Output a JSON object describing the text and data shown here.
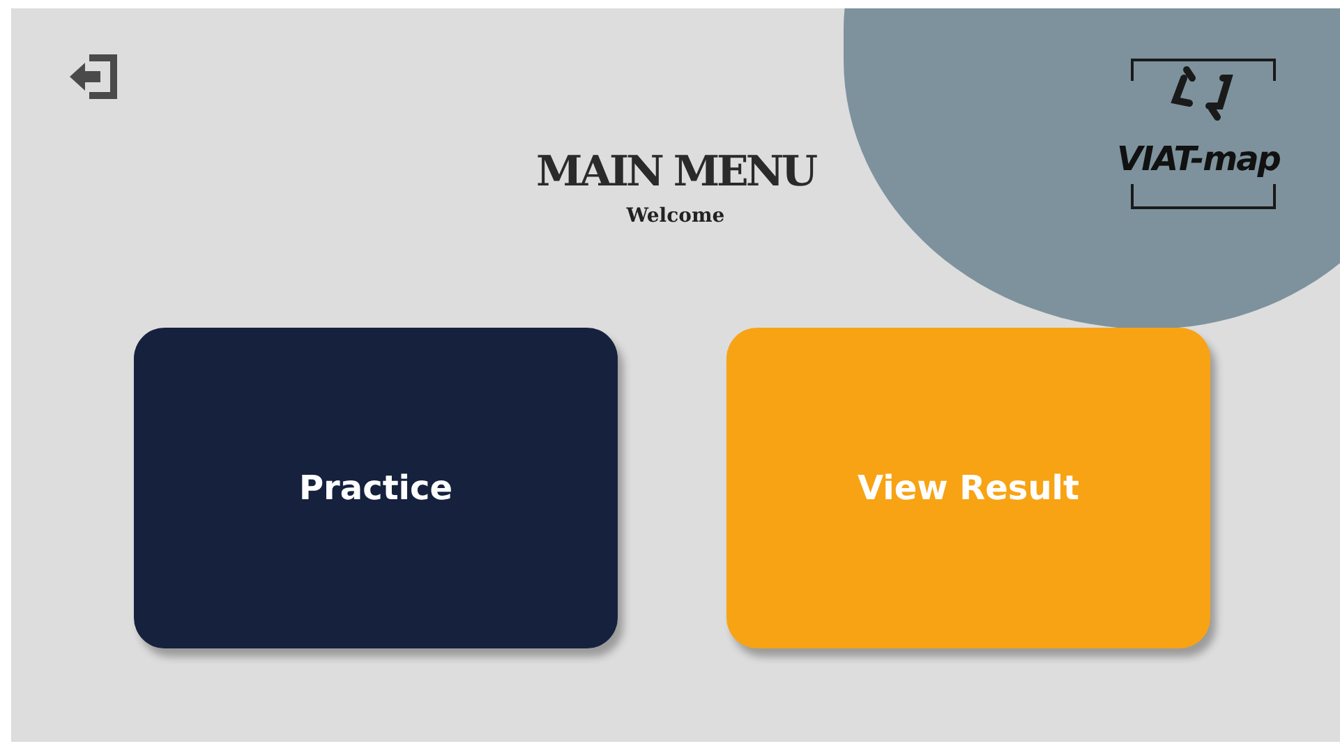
{
  "header": {
    "title": "MAIN MENU",
    "subtitle": "Welcome"
  },
  "logo": {
    "text": "VIAT-map"
  },
  "buttons": [
    {
      "label": "Practice",
      "kind": "dark"
    },
    {
      "label": "View Result",
      "kind": "accent"
    }
  ]
}
